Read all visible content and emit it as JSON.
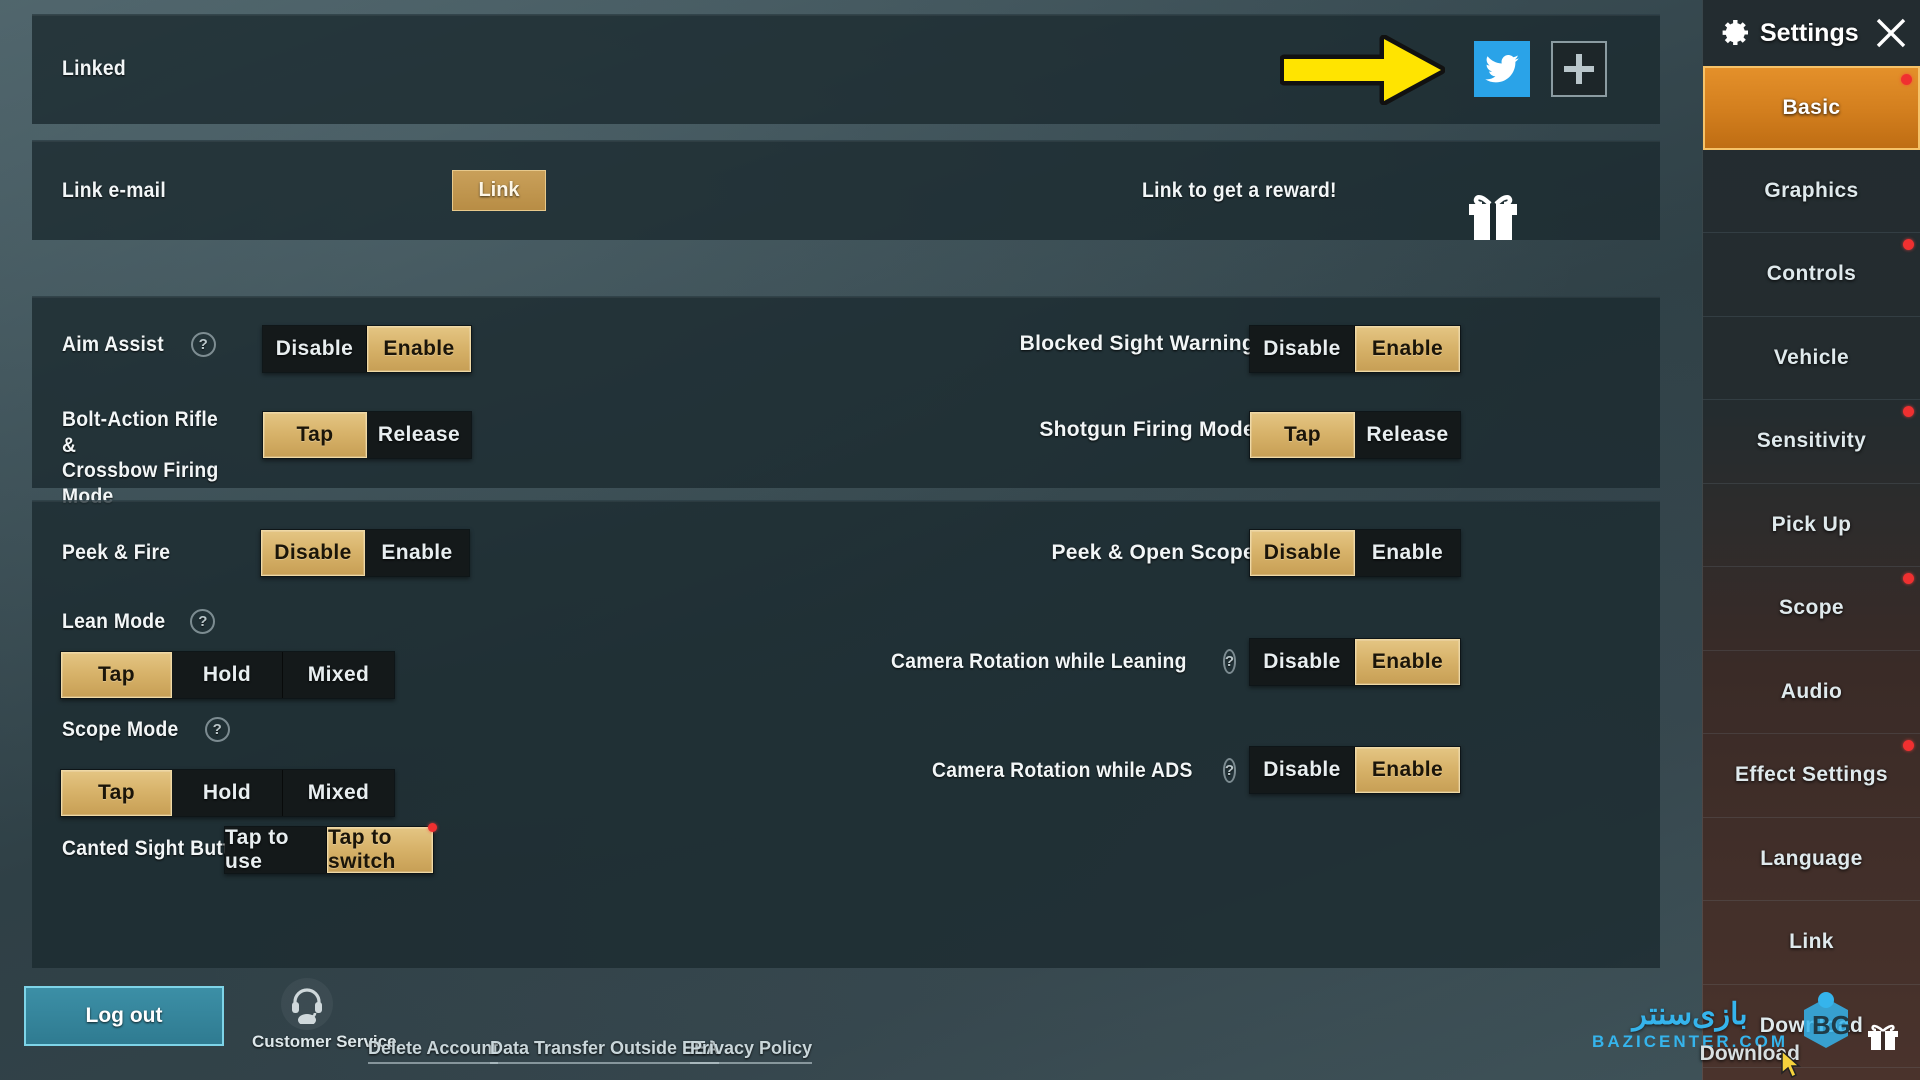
{
  "sidebar": {
    "title": "Settings",
    "close_icon": "close-x-icon",
    "gear_icon": "gear-icon",
    "items": [
      {
        "label": "Basic",
        "active": true,
        "badge": true
      },
      {
        "label": "Graphics",
        "active": false,
        "badge": false
      },
      {
        "label": "Controls",
        "active": false,
        "badge": true
      },
      {
        "label": "Vehicle",
        "active": false,
        "badge": false
      },
      {
        "label": "Sensitivity",
        "active": false,
        "badge": true
      },
      {
        "label": "Pick Up",
        "active": false,
        "badge": false
      },
      {
        "label": "Scope",
        "active": false,
        "badge": true
      },
      {
        "label": "Audio",
        "active": false,
        "badge": false
      },
      {
        "label": "Effect Settings",
        "active": false,
        "badge": true
      },
      {
        "label": "Language",
        "active": false,
        "badge": false
      },
      {
        "label": "Link",
        "active": false,
        "badge": false
      },
      {
        "label": "Download",
        "active": false,
        "badge": false
      }
    ]
  },
  "linked_section": {
    "title": "Linked",
    "twitter_icon": "twitter-bird-icon",
    "add_icon": "plus-icon",
    "annotation_icon": "yellow-arrow-annotation"
  },
  "email_section": {
    "label": "Link e-mail",
    "button": "Link",
    "reward_text": "Link to get a reward!",
    "gift_icon": "gift-box-icon"
  },
  "aim_section": {
    "aim_assist": {
      "label": "Aim Assist",
      "help": "?",
      "options": [
        "Disable",
        "Enable"
      ],
      "selected": "Enable"
    },
    "bolt_action": {
      "label": "Bolt-Action Rifle &\nCrossbow Firing Mode",
      "label_line1": "Bolt-Action Rifle &",
      "label_line2": "Crossbow Firing Mode",
      "options": [
        "Tap",
        "Release"
      ],
      "selected": "Tap"
    },
    "blocked_sight": {
      "label": "Blocked Sight Warning",
      "options": [
        "Disable",
        "Enable"
      ],
      "selected": "Enable"
    },
    "shotgun": {
      "label": "Shotgun Firing Mode",
      "options": [
        "Tap",
        "Release"
      ],
      "selected": "Tap"
    }
  },
  "peek_section": {
    "peek_fire": {
      "label": "Peek & Fire",
      "options": [
        "Disable",
        "Enable"
      ],
      "selected": "Disable"
    },
    "lean_mode": {
      "label": "Lean Mode",
      "help": "?",
      "options": [
        "Tap",
        "Hold",
        "Mixed"
      ],
      "selected": "Tap"
    },
    "scope_mode": {
      "label": "Scope Mode",
      "help": "?",
      "options": [
        "Tap",
        "Hold",
        "Mixed"
      ],
      "selected": "Tap"
    },
    "canted_sight": {
      "label": "Canted Sight Button",
      "options": [
        "Tap to use",
        "Tap to switch"
      ],
      "selected": "Tap to switch",
      "badge": true
    },
    "peek_open_scope": {
      "label": "Peek & Open Scope",
      "options": [
        "Disable",
        "Enable"
      ],
      "selected": "Disable"
    },
    "camera_lean": {
      "label": "Camera Rotation while Leaning",
      "help": "?",
      "options": [
        "Disable",
        "Enable"
      ],
      "selected": "Enable"
    },
    "camera_ads": {
      "label": "Camera Rotation while ADS",
      "help": "?",
      "options": [
        "Disable",
        "Enable"
      ],
      "selected": "Enable"
    }
  },
  "bottom_bar": {
    "logout": "Log out",
    "customer_service": "Customer Service",
    "customer_service_icon": "headset-support-icon",
    "links": [
      "Delete Account",
      "Data Transfer Outside EEA",
      "Privacy Policy"
    ]
  },
  "watermark": {
    "site_fa": "بازی‌سنتر",
    "site_en": "BAZICENTER.COM",
    "download_label": "Download",
    "logo_icon": "bazicenter-bg-logo"
  },
  "colors": {
    "accent_gold": "#d7b269",
    "accent_orange": "#d4801f",
    "panel_bg": "#1c2a2f",
    "twitter_blue": "#2aa3e8",
    "logout_blue": "#2f7b91",
    "badge_red": "#f03030"
  }
}
